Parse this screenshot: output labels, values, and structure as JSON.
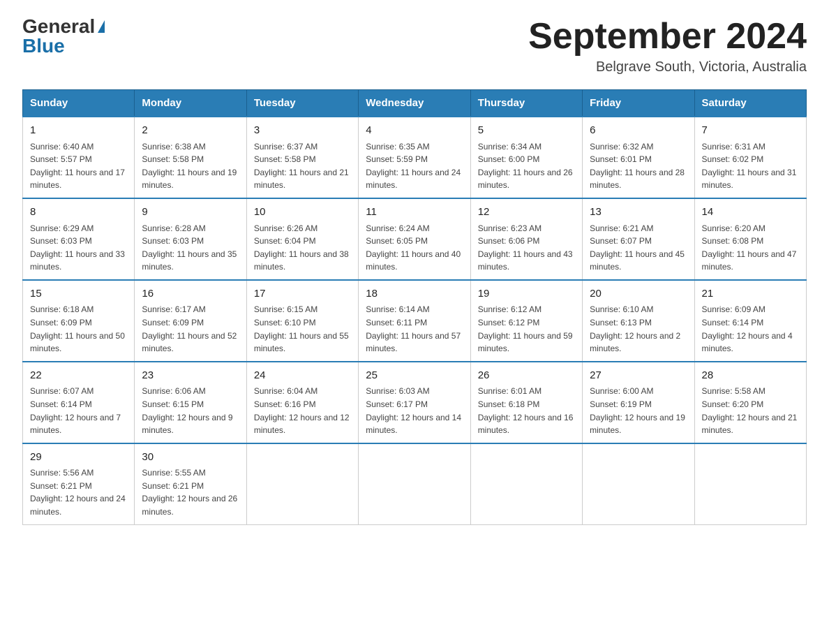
{
  "header": {
    "logo_general": "General",
    "logo_blue": "Blue",
    "title": "September 2024",
    "subtitle": "Belgrave South, Victoria, Australia"
  },
  "weekdays": [
    "Sunday",
    "Monday",
    "Tuesday",
    "Wednesday",
    "Thursday",
    "Friday",
    "Saturday"
  ],
  "weeks": [
    [
      {
        "num": "1",
        "sunrise": "6:40 AM",
        "sunset": "5:57 PM",
        "daylight": "11 hours and 17 minutes."
      },
      {
        "num": "2",
        "sunrise": "6:38 AM",
        "sunset": "5:58 PM",
        "daylight": "11 hours and 19 minutes."
      },
      {
        "num": "3",
        "sunrise": "6:37 AM",
        "sunset": "5:58 PM",
        "daylight": "11 hours and 21 minutes."
      },
      {
        "num": "4",
        "sunrise": "6:35 AM",
        "sunset": "5:59 PM",
        "daylight": "11 hours and 24 minutes."
      },
      {
        "num": "5",
        "sunrise": "6:34 AM",
        "sunset": "6:00 PM",
        "daylight": "11 hours and 26 minutes."
      },
      {
        "num": "6",
        "sunrise": "6:32 AM",
        "sunset": "6:01 PM",
        "daylight": "11 hours and 28 minutes."
      },
      {
        "num": "7",
        "sunrise": "6:31 AM",
        "sunset": "6:02 PM",
        "daylight": "11 hours and 31 minutes."
      }
    ],
    [
      {
        "num": "8",
        "sunrise": "6:29 AM",
        "sunset": "6:03 PM",
        "daylight": "11 hours and 33 minutes."
      },
      {
        "num": "9",
        "sunrise": "6:28 AM",
        "sunset": "6:03 PM",
        "daylight": "11 hours and 35 minutes."
      },
      {
        "num": "10",
        "sunrise": "6:26 AM",
        "sunset": "6:04 PM",
        "daylight": "11 hours and 38 minutes."
      },
      {
        "num": "11",
        "sunrise": "6:24 AM",
        "sunset": "6:05 PM",
        "daylight": "11 hours and 40 minutes."
      },
      {
        "num": "12",
        "sunrise": "6:23 AM",
        "sunset": "6:06 PM",
        "daylight": "11 hours and 43 minutes."
      },
      {
        "num": "13",
        "sunrise": "6:21 AM",
        "sunset": "6:07 PM",
        "daylight": "11 hours and 45 minutes."
      },
      {
        "num": "14",
        "sunrise": "6:20 AM",
        "sunset": "6:08 PM",
        "daylight": "11 hours and 47 minutes."
      }
    ],
    [
      {
        "num": "15",
        "sunrise": "6:18 AM",
        "sunset": "6:09 PM",
        "daylight": "11 hours and 50 minutes."
      },
      {
        "num": "16",
        "sunrise": "6:17 AM",
        "sunset": "6:09 PM",
        "daylight": "11 hours and 52 minutes."
      },
      {
        "num": "17",
        "sunrise": "6:15 AM",
        "sunset": "6:10 PM",
        "daylight": "11 hours and 55 minutes."
      },
      {
        "num": "18",
        "sunrise": "6:14 AM",
        "sunset": "6:11 PM",
        "daylight": "11 hours and 57 minutes."
      },
      {
        "num": "19",
        "sunrise": "6:12 AM",
        "sunset": "6:12 PM",
        "daylight": "11 hours and 59 minutes."
      },
      {
        "num": "20",
        "sunrise": "6:10 AM",
        "sunset": "6:13 PM",
        "daylight": "12 hours and 2 minutes."
      },
      {
        "num": "21",
        "sunrise": "6:09 AM",
        "sunset": "6:14 PM",
        "daylight": "12 hours and 4 minutes."
      }
    ],
    [
      {
        "num": "22",
        "sunrise": "6:07 AM",
        "sunset": "6:14 PM",
        "daylight": "12 hours and 7 minutes."
      },
      {
        "num": "23",
        "sunrise": "6:06 AM",
        "sunset": "6:15 PM",
        "daylight": "12 hours and 9 minutes."
      },
      {
        "num": "24",
        "sunrise": "6:04 AM",
        "sunset": "6:16 PM",
        "daylight": "12 hours and 12 minutes."
      },
      {
        "num": "25",
        "sunrise": "6:03 AM",
        "sunset": "6:17 PM",
        "daylight": "12 hours and 14 minutes."
      },
      {
        "num": "26",
        "sunrise": "6:01 AM",
        "sunset": "6:18 PM",
        "daylight": "12 hours and 16 minutes."
      },
      {
        "num": "27",
        "sunrise": "6:00 AM",
        "sunset": "6:19 PM",
        "daylight": "12 hours and 19 minutes."
      },
      {
        "num": "28",
        "sunrise": "5:58 AM",
        "sunset": "6:20 PM",
        "daylight": "12 hours and 21 minutes."
      }
    ],
    [
      {
        "num": "29",
        "sunrise": "5:56 AM",
        "sunset": "6:21 PM",
        "daylight": "12 hours and 24 minutes."
      },
      {
        "num": "30",
        "sunrise": "5:55 AM",
        "sunset": "6:21 PM",
        "daylight": "12 hours and 26 minutes."
      },
      null,
      null,
      null,
      null,
      null
    ]
  ]
}
